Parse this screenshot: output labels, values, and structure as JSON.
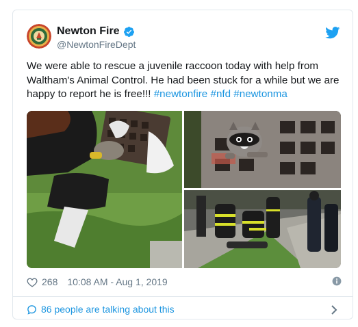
{
  "account": {
    "display_name": "Newton Fire",
    "handle": "@NewtonFireDept",
    "verified": true,
    "avatar_icon": "newton-fire-seal-icon"
  },
  "tweet": {
    "text": "We were able to rescue a juvenile raccoon today with help from Waltham's Animal Control. He had been stuck for a while but we are happy to report he is free!!! ",
    "hashtags": [
      "#newtonfire",
      "#nfd",
      "#newtonma"
    ]
  },
  "media": {
    "photos": [
      {
        "icon": "photo-rescue-grass"
      },
      {
        "icon": "photo-raccoon-in-grate"
      },
      {
        "icon": "photo-firefighters-kneeling"
      }
    ]
  },
  "engagement": {
    "like_count": "268",
    "timestamp": "10:08 AM - Aug 1, 2019"
  },
  "footer": {
    "conversation_label": "86 people are talking about this"
  },
  "colors": {
    "link": "#1b95e0",
    "secondary_text": "#657786",
    "border": "#e1e8ed",
    "verified_badge": "#1da1f2"
  }
}
